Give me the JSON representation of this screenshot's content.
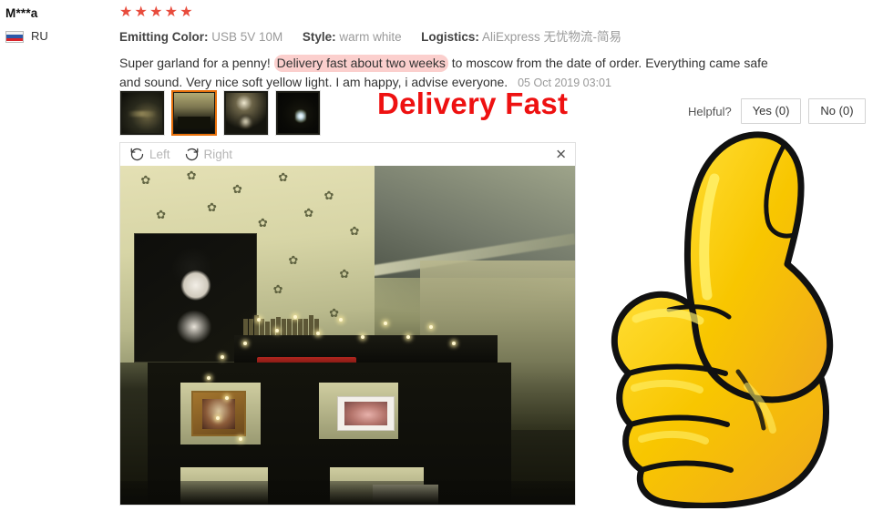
{
  "reviewer": {
    "name": "M***a",
    "country_code": "RU",
    "flag_icon": "ru-flag-icon"
  },
  "rating": {
    "stars_filled": 5,
    "star_glyph": "★",
    "star_color": "#e84c3d"
  },
  "attributes": [
    {
      "key": "Emitting Color:",
      "value": "USB 5V 10M"
    },
    {
      "key": "Style:",
      "value": "warm white"
    },
    {
      "key": "Logistics:",
      "value": "AliExpress 无忧物流-简易"
    }
  ],
  "review": {
    "text_before": "Super garland for a penny!",
    "highlight": "Delivery fast about two weeks",
    "highlight_color": "#fbcfcd",
    "text_after": "to moscow from the date of order. Everything came safe and sound. Very nice soft yellow light. I am happy, i advise everyone.",
    "date": "05 Oct 2019 03:01"
  },
  "thumbnails": [
    {
      "name": "thumbnail-1",
      "selected": false
    },
    {
      "name": "thumbnail-2",
      "selected": true
    },
    {
      "name": "thumbnail-3",
      "selected": false
    },
    {
      "name": "thumbnail-4",
      "selected": false
    }
  ],
  "viewer": {
    "rotate_left_label": "Left",
    "rotate_right_label": "Right",
    "rotate_left_icon": "rotate-counterclockwise-icon",
    "rotate_right_icon": "rotate-clockwise-icon",
    "close_label": "✕",
    "photo_alt": "review-photo-room-with-string-lights"
  },
  "annotation": {
    "text": "Delivery Fast",
    "color": "#ee1111"
  },
  "helpful": {
    "label": "Helpful?",
    "yes_label": "Yes (0)",
    "no_label": "No (0)"
  },
  "graphic": {
    "name": "thumbs-up-icon",
    "fill": "#f5c500",
    "highlight": "#ffe24d",
    "shade": "#f0a81e",
    "outline": "#111111"
  }
}
